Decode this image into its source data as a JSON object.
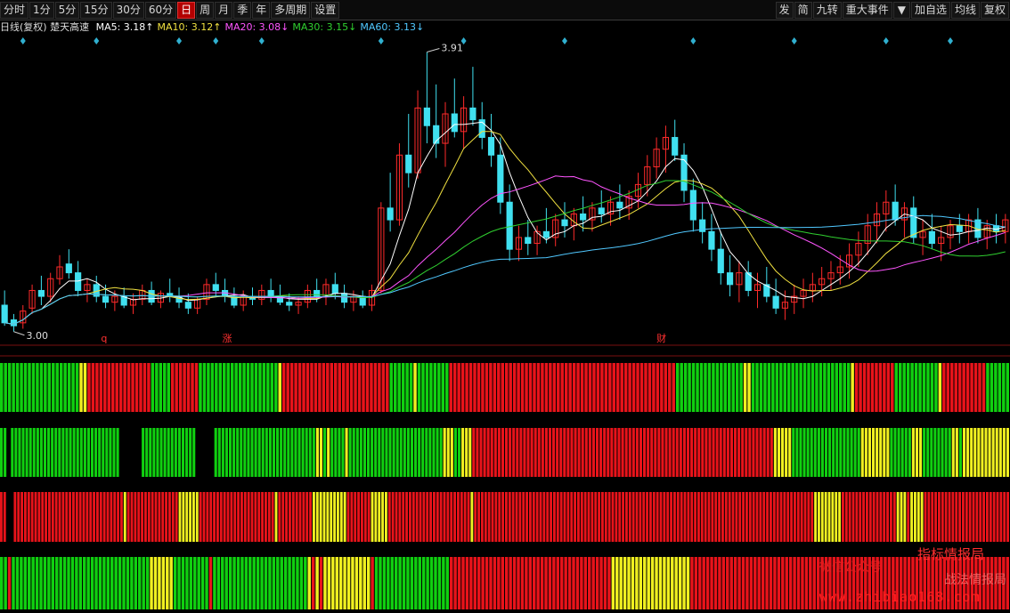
{
  "toolbar": {
    "left": [
      {
        "label": "分时",
        "name": "tab-intraday"
      },
      {
        "label": "1分",
        "name": "tab-1min"
      },
      {
        "label": "5分",
        "name": "tab-5min"
      },
      {
        "label": "15分",
        "name": "tab-15min"
      },
      {
        "label": "30分",
        "name": "tab-30min"
      },
      {
        "label": "60分",
        "name": "tab-60min"
      },
      {
        "label": "日",
        "name": "tab-day",
        "active": true
      },
      {
        "label": "周",
        "name": "tab-week"
      },
      {
        "label": "月",
        "name": "tab-month"
      },
      {
        "label": "季",
        "name": "tab-quarter"
      },
      {
        "label": "年",
        "name": "tab-year"
      },
      {
        "label": "多周期",
        "name": "tab-multi-period"
      },
      {
        "label": "设置",
        "name": "settings-button"
      }
    ],
    "right": [
      {
        "label": "发",
        "name": "send-button"
      },
      {
        "label": "简",
        "name": "simple-button"
      },
      {
        "label": "九转",
        "name": "nine-turn-button"
      },
      {
        "label": "重大事件",
        "name": "major-events-button"
      },
      {
        "label": "▼",
        "name": "dropdown-button"
      },
      {
        "label": "加自选",
        "name": "add-watchlist-button"
      },
      {
        "label": "均线",
        "name": "moving-average-button"
      },
      {
        "label": "复权",
        "name": "adjust-button"
      }
    ]
  },
  "ma_line": {
    "prefix": "日线(复权) 楚天高速",
    "items": [
      {
        "label": "MA5: 3.18↑",
        "color": "#ffffff"
      },
      {
        "label": "MA10: 3.12↑",
        "color": "#f0e040"
      },
      {
        "label": "MA20: 3.08↓",
        "color": "#ff55ff"
      },
      {
        "label": "MA30: 3.15↓",
        "color": "#30d030"
      },
      {
        "label": "MA60: 3.13↓",
        "color": "#50c8ff"
      }
    ]
  },
  "colors": {
    "up": "#ff2a2a",
    "down": "#40e0f0",
    "ma5": "#ffffff",
    "ma10": "#f0e040",
    "ma20": "#ff55ff",
    "ma30": "#30d030",
    "ma60": "#50c8ff",
    "bar_red": "#e8131a",
    "bar_green": "#10d010",
    "bar_yellow": "#f0f020"
  },
  "chart_data": [
    {
      "type": "candlestick",
      "annotations": {
        "high": "3.91",
        "low": "3.00"
      },
      "markers": [
        "q",
        "涨",
        "财"
      ],
      "ylim": [
        2.92,
        3.96
      ],
      "candles": [
        [
          3.05,
          3.1,
          2.98,
          2.99
        ],
        [
          3.0,
          3.02,
          2.96,
          2.98
        ],
        [
          2.99,
          3.05,
          2.97,
          3.03
        ],
        [
          3.04,
          3.12,
          3.02,
          3.1
        ],
        [
          3.1,
          3.15,
          3.05,
          3.08
        ],
        [
          3.08,
          3.16,
          3.06,
          3.14
        ],
        [
          3.14,
          3.22,
          3.12,
          3.18
        ],
        [
          3.19,
          3.24,
          3.14,
          3.16
        ],
        [
          3.16,
          3.2,
          3.08,
          3.1
        ],
        [
          3.1,
          3.14,
          3.06,
          3.12
        ],
        [
          3.12,
          3.15,
          3.06,
          3.08
        ],
        [
          3.08,
          3.12,
          3.04,
          3.06
        ],
        [
          3.06,
          3.1,
          3.03,
          3.08
        ],
        [
          3.08,
          3.11,
          3.04,
          3.05
        ],
        [
          3.05,
          3.09,
          3.02,
          3.07
        ],
        [
          3.07,
          3.12,
          3.05,
          3.1
        ],
        [
          3.1,
          3.13,
          3.05,
          3.06
        ],
        [
          3.06,
          3.1,
          3.04,
          3.09
        ],
        [
          3.09,
          3.14,
          3.06,
          3.08
        ],
        [
          3.08,
          3.11,
          3.04,
          3.06
        ],
        [
          3.06,
          3.09,
          3.02,
          3.04
        ],
        [
          3.04,
          3.08,
          3.02,
          3.07
        ],
        [
          3.07,
          3.14,
          3.05,
          3.12
        ],
        [
          3.12,
          3.16,
          3.08,
          3.1
        ],
        [
          3.1,
          3.14,
          3.06,
          3.08
        ],
        [
          3.08,
          3.11,
          3.04,
          3.05
        ],
        [
          3.05,
          3.1,
          3.03,
          3.08
        ],
        [
          3.08,
          3.11,
          3.05,
          3.07
        ],
        [
          3.07,
          3.12,
          3.05,
          3.1
        ],
        [
          3.1,
          3.14,
          3.06,
          3.08
        ],
        [
          3.08,
          3.12,
          3.05,
          3.06
        ],
        [
          3.06,
          3.09,
          3.03,
          3.05
        ],
        [
          3.05,
          3.08,
          3.02,
          3.06
        ],
        [
          3.06,
          3.12,
          3.04,
          3.1
        ],
        [
          3.1,
          3.14,
          3.06,
          3.08
        ],
        [
          3.08,
          3.14,
          3.05,
          3.12
        ],
        [
          3.12,
          3.16,
          3.07,
          3.09
        ],
        [
          3.09,
          3.12,
          3.04,
          3.06
        ],
        [
          3.06,
          3.1,
          3.03,
          3.08
        ],
        [
          3.08,
          3.1,
          3.04,
          3.05
        ],
        [
          3.05,
          3.12,
          3.03,
          3.1
        ],
        [
          3.1,
          3.4,
          3.09,
          3.38
        ],
        [
          3.38,
          3.5,
          3.3,
          3.34
        ],
        [
          3.34,
          3.6,
          3.32,
          3.56
        ],
        [
          3.56,
          3.7,
          3.45,
          3.5
        ],
        [
          3.5,
          3.78,
          3.48,
          3.72
        ],
        [
          3.72,
          3.91,
          3.6,
          3.66
        ],
        [
          3.66,
          3.8,
          3.55,
          3.6
        ],
        [
          3.6,
          3.74,
          3.52,
          3.7
        ],
        [
          3.7,
          3.82,
          3.62,
          3.64
        ],
        [
          3.64,
          3.76,
          3.58,
          3.72
        ],
        [
          3.72,
          3.86,
          3.66,
          3.68
        ],
        [
          3.68,
          3.74,
          3.58,
          3.62
        ],
        [
          3.62,
          3.7,
          3.52,
          3.56
        ],
        [
          3.56,
          3.62,
          3.36,
          3.4
        ],
        [
          3.4,
          3.46,
          3.2,
          3.24
        ],
        [
          3.24,
          3.32,
          3.2,
          3.28
        ],
        [
          3.28,
          3.34,
          3.22,
          3.26
        ],
        [
          3.26,
          3.32,
          3.22,
          3.3
        ],
        [
          3.3,
          3.38,
          3.26,
          3.28
        ],
        [
          3.28,
          3.36,
          3.25,
          3.34
        ],
        [
          3.34,
          3.4,
          3.28,
          3.32
        ],
        [
          3.32,
          3.38,
          3.27,
          3.36
        ],
        [
          3.36,
          3.42,
          3.3,
          3.34
        ],
        [
          3.34,
          3.4,
          3.3,
          3.38
        ],
        [
          3.38,
          3.44,
          3.33,
          3.36
        ],
        [
          3.36,
          3.42,
          3.32,
          3.4
        ],
        [
          3.4,
          3.46,
          3.34,
          3.38
        ],
        [
          3.38,
          3.44,
          3.34,
          3.42
        ],
        [
          3.42,
          3.5,
          3.38,
          3.46
        ],
        [
          3.46,
          3.56,
          3.42,
          3.52
        ],
        [
          3.52,
          3.62,
          3.48,
          3.58
        ],
        [
          3.58,
          3.66,
          3.5,
          3.62
        ],
        [
          3.62,
          3.68,
          3.54,
          3.56
        ],
        [
          3.56,
          3.6,
          3.4,
          3.44
        ],
        [
          3.44,
          3.48,
          3.3,
          3.34
        ],
        [
          3.34,
          3.4,
          3.26,
          3.3
        ],
        [
          3.3,
          3.36,
          3.2,
          3.24
        ],
        [
          3.24,
          3.3,
          3.12,
          3.16
        ],
        [
          3.16,
          3.22,
          3.08,
          3.12
        ],
        [
          3.12,
          3.2,
          3.06,
          3.16
        ],
        [
          3.16,
          3.2,
          3.08,
          3.1
        ],
        [
          3.1,
          3.16,
          3.04,
          3.12
        ],
        [
          3.12,
          3.18,
          3.06,
          3.08
        ],
        [
          3.08,
          3.14,
          3.02,
          3.04
        ],
        [
          3.04,
          3.1,
          3.0,
          3.06
        ],
        [
          3.06,
          3.12,
          3.02,
          3.08
        ],
        [
          3.08,
          3.14,
          3.04,
          3.1
        ],
        [
          3.1,
          3.16,
          3.06,
          3.12
        ],
        [
          3.12,
          3.18,
          3.08,
          3.14
        ],
        [
          3.14,
          3.2,
          3.1,
          3.16
        ],
        [
          3.16,
          3.22,
          3.12,
          3.18
        ],
        [
          3.18,
          3.26,
          3.14,
          3.22
        ],
        [
          3.22,
          3.3,
          3.18,
          3.26
        ],
        [
          3.26,
          3.36,
          3.22,
          3.32
        ],
        [
          3.32,
          3.4,
          3.26,
          3.36
        ],
        [
          3.36,
          3.44,
          3.3,
          3.4
        ],
        [
          3.4,
          3.46,
          3.32,
          3.34
        ],
        [
          3.34,
          3.4,
          3.28,
          3.38
        ],
        [
          3.38,
          3.42,
          3.26,
          3.28
        ],
        [
          3.28,
          3.34,
          3.22,
          3.3
        ],
        [
          3.3,
          3.36,
          3.24,
          3.26
        ],
        [
          3.26,
          3.32,
          3.2,
          3.28
        ],
        [
          3.28,
          3.34,
          3.24,
          3.32
        ],
        [
          3.32,
          3.36,
          3.26,
          3.3
        ],
        [
          3.3,
          3.36,
          3.26,
          3.34
        ],
        [
          3.34,
          3.38,
          3.26,
          3.28
        ],
        [
          3.28,
          3.34,
          3.24,
          3.32
        ],
        [
          3.32,
          3.36,
          3.26,
          3.3
        ],
        [
          3.3,
          3.36,
          3.26,
          3.34
        ]
      ]
    },
    {
      "type": "signal-bars",
      "colors": "GGGGGGGGGGGGGGGGGGGGYYRRRRRRRRRRRRRRRRGGGGGRRRRRRRGGGGGGGGGGGGGGGGGGGGYRRRRRRRRRRRRRRRRRRRRRRRRRRRGGGGGGYGGGGGGGGRRRRRRRRRRRRRRRRRRRRRRRRRRRRRRRRRRRRRRRRRRRRRRRRRRRRRRRRRGGGGGGGGGGGGGGGGGYYGGGGGGGGGGGGGGGGGGGGGGGGGYRRRRRRRRRRGGGGGGGGGGGYRRRRRRRRRRRGGGGGG"
    },
    {
      "type": "signal-bars",
      "colors": "GG_GGGGGGGGGGGGGGGGGGGGGGGGGGGGGG______GGGGGGGGGGGGGGG_____GGGGGGGGGGGGGGGGGGGGGGGGGGGGYYGYGGGGYGGGGGGGGGGGGGGGGGGGGGGGGGGYYYGGYYYRRRRRRRRRRRRRRRRRRRRRRRRRRRRRRRRRRRRRRRRRRRRRRRRRRRRRRRRRRRRRRRRRRRRRRRRRRRRRRRRRRRYYYYYGGGGGGGGGGGGGGGGGGGYYYYYYYYGGGGGGYYYGGGGGGGGYYGYYYYYYYYYYYYY"
    },
    {
      "type": "signal-bars",
      "colors": "RR__RRRRRRRRRRRRRRRRRRRRRRRRRRRRRRRRYRRRRRRRRRRRRRRRYYYYYYRRRRRRRRRRRRRRRRRRRRRRYRRRRRRRRRRYYYYYYYYYYRRRRRRRYYYYYRRRRRRRRRRRRRRRRRRRRRRRRYRRRRRRRRRRRRRRRRRRRRRRRRRRRRRRRRRRRRRRRRRRRRRRRRRRRRRRRRRRRRRRRRRRRRRRRRRRRRRRRRRRRRRRRRRRRRRRRRRRRYYYYYYYYRRRRRRRRRRRRRRRRYYYRYYYYRRRRRRRRRRRRRRRRRRRRRRRRR"
    },
    {
      "type": "signal-bars",
      "colors": "GGRGGGGGGGGGGGGGGGGGGGGGGGGGGGGGGGGGGGYYYYYYGGGGGGGGGRGGGGGGGGGGGGGGGGGGGGGGGGYRYRYYYYYYYYYYYYRGGGGGGGGGGGGGGGGGGGRRRRRRRRRRRRRRRRRRRRRRRRRRRRRRRRRRRRRRRRRYYYYYYYYYYYYYYYYYYYYRRRRRRRRRRRRRRRRRRRRRRRRRRRRRRRRRRRRRRRRRRRRRRRRRRRRRRRRRRRRRRRRRRRRRRRRRRRRRRRRR"
    }
  ],
  "watermark": {
    "line1": "微信公众号",
    "line2": "指标情报局",
    "line3": "战法情报局",
    "url": "www.zhibiao168.com"
  }
}
